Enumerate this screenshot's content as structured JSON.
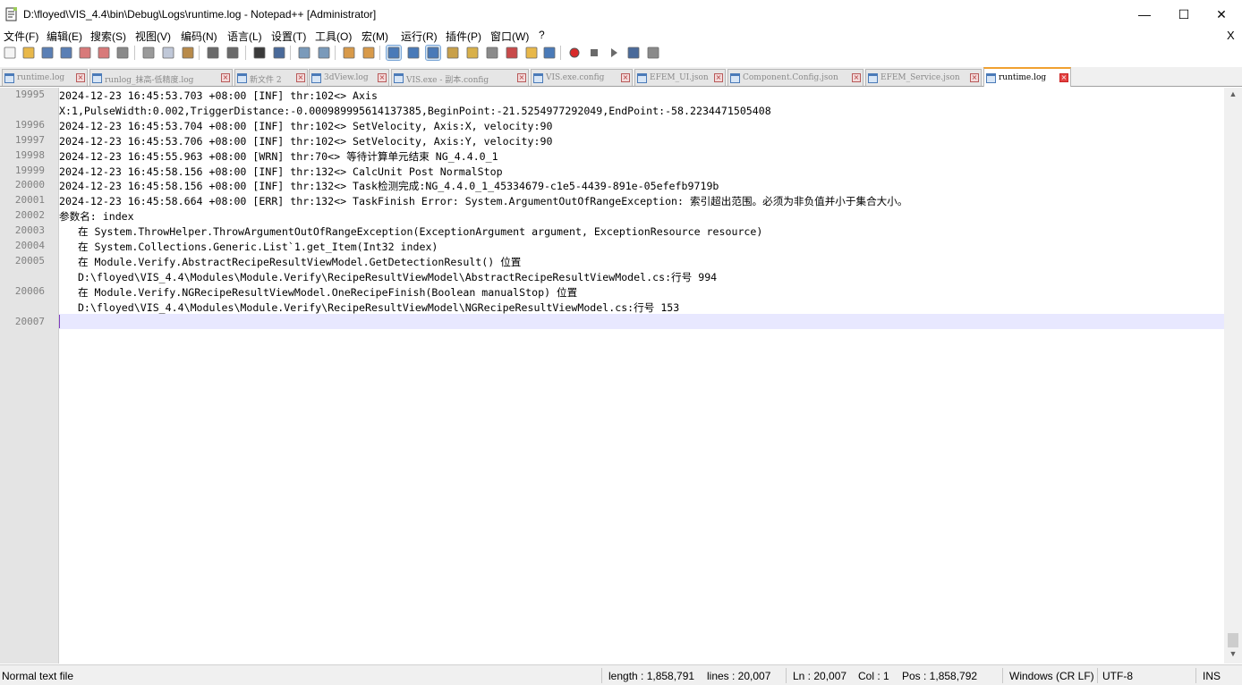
{
  "window": {
    "title": "D:\\floyed\\VIS_4.4\\bin\\Debug\\Logs\\runtime.log - Notepad++ [Administrator]",
    "minimize_glyph": "—",
    "maximize_glyph": "☐",
    "close_glyph": "✕"
  },
  "menu": {
    "items": [
      "文件(F)",
      "编辑(E)",
      "搜索(S)",
      "视图(V)",
      "编码(N)",
      "语言(L)",
      "设置(T)",
      "工具(O)",
      "宏(M)",
      "运行(R)",
      "插件(P)",
      "窗口(W)",
      "?"
    ],
    "close_glyph": "X"
  },
  "toolbar": {
    "buttons": [
      {
        "name": "new-file-icon",
        "color": "#f4f4f4"
      },
      {
        "name": "open-file-icon",
        "color": "#e8b84a"
      },
      {
        "name": "save-icon",
        "color": "#5a7fb5"
      },
      {
        "name": "save-all-icon",
        "color": "#5a7fb5"
      },
      {
        "name": "close-icon",
        "color": "#d87a7a"
      },
      {
        "name": "close-all-icon",
        "color": "#d87a7a"
      },
      {
        "name": "print-icon",
        "color": "#8a8a8a"
      },
      {
        "name": "cut-icon",
        "color": "#9a9a9a"
      },
      {
        "name": "copy-icon",
        "color": "#c0c8d8"
      },
      {
        "name": "paste-icon",
        "color": "#b88a4a"
      },
      {
        "name": "undo-icon",
        "color": "#6a6a6a"
      },
      {
        "name": "redo-icon",
        "color": "#6a6a6a"
      },
      {
        "name": "find-icon",
        "color": "#3a3a3a"
      },
      {
        "name": "replace-icon",
        "color": "#4a6a9a"
      },
      {
        "name": "zoom-in-icon",
        "color": "#7a9aba"
      },
      {
        "name": "zoom-out-icon",
        "color": "#7a9aba"
      },
      {
        "name": "sync-vertical-icon",
        "color": "#d89a4a"
      },
      {
        "name": "sync-horizontal-icon",
        "color": "#d89a4a"
      },
      {
        "name": "word-wrap-icon",
        "color": "#4a7ab8"
      },
      {
        "name": "show-all-chars-icon",
        "color": "#4a7ab8"
      },
      {
        "name": "indent-guide-icon",
        "color": "#4a7ab8"
      },
      {
        "name": "define-language-icon",
        "color": "#c8a04a"
      },
      {
        "name": "doc-map-icon",
        "color": "#d8b04a"
      },
      {
        "name": "doc-list-icon",
        "color": "#8a8a8a"
      },
      {
        "name": "function-list-icon",
        "color": "#c84a4a"
      },
      {
        "name": "folder-workspace-icon",
        "color": "#e8b84a"
      },
      {
        "name": "monitoring-icon",
        "color": "#4a7ab8"
      },
      {
        "name": "record-macro-icon",
        "color": "#d82a2a"
      },
      {
        "name": "stop-record-icon",
        "color": "#6a6a6a"
      },
      {
        "name": "play-macro-icon",
        "color": "#6a6a6a"
      },
      {
        "name": "run-macro-multiple-icon",
        "color": "#4a6a9a"
      },
      {
        "name": "save-macro-icon",
        "color": "#8a8a8a"
      }
    ]
  },
  "tabs": [
    {
      "label": "runtime.log",
      "active": false
    },
    {
      "label": "runlog_抹高-低精度.log",
      "active": false
    },
    {
      "label": "新文件 2",
      "active": false
    },
    {
      "label": "3dView.log",
      "active": false
    },
    {
      "label": "VIS.exe - 副本.config",
      "active": false
    },
    {
      "label": "VIS.exe.config",
      "active": false
    },
    {
      "label": "EFEM_UI.json",
      "active": false
    },
    {
      "label": "Component.Config.json",
      "active": false
    },
    {
      "label": "EFEM_Service.json",
      "active": false
    },
    {
      "label": "runtime.log",
      "active": true
    }
  ],
  "editor": {
    "line_numbers": [
      "19995",
      "",
      "19996",
      "19997",
      "19998",
      "19999",
      "20000",
      "20001",
      "20002",
      "20003",
      "20004",
      "20005",
      "",
      "20006",
      "",
      "20007"
    ],
    "lines": [
      "2024-12-23 16:45:53.703 +08:00 [INF] thr:102<> Axis",
      "X:1,PulseWidth:0.002,TriggerDistance:-0.000989995614137385,BeginPoint:-21.5254977292049,EndPoint:-58.2234471505408",
      "2024-12-23 16:45:53.704 +08:00 [INF] thr:102<> SetVelocity, Axis:X, velocity:90",
      "2024-12-23 16:45:53.706 +08:00 [INF] thr:102<> SetVelocity, Axis:Y, velocity:90",
      "2024-12-23 16:45:55.963 +08:00 [WRN] thr:70<> 等待计算单元结束 NG_4.4.0_1",
      "2024-12-23 16:45:58.156 +08:00 [INF] thr:132<> CalcUnit Post NormalStop",
      "2024-12-23 16:45:58.156 +08:00 [INF] thr:132<> Task检测完成:NG_4.4.0_1_45334679-c1e5-4439-891e-05efefb9719b",
      "2024-12-23 16:45:58.664 +08:00 [ERR] thr:132<> TaskFinish Error: System.ArgumentOutOfRangeException: 索引超出范围。必须为非负值并小于集合大小。",
      "参数名: index",
      "   在 System.ThrowHelper.ThrowArgumentOutOfRangeException(ExceptionArgument argument, ExceptionResource resource)",
      "   在 System.Collections.Generic.List`1.get_Item(Int32 index)",
      "   在 Module.Verify.AbstractRecipeResultViewModel.GetDetectionResult() 位置",
      "   D:\\floyed\\VIS_4.4\\Modules\\Module.Verify\\RecipeResultViewModel\\AbstractRecipeResultViewModel.cs:行号 994",
      "   在 Module.Verify.NGRecipeResultViewModel.OneRecipeFinish(Boolean manualStop) 位置",
      "   D:\\floyed\\VIS_4.4\\Modules\\Module.Verify\\RecipeResultViewModel\\NGRecipeResultViewModel.cs:行号 153",
      ""
    ],
    "caret_line_color": "#e8e8ff",
    "gutter_color": "#e4e4e4"
  },
  "scrollbar": {
    "up_glyph": "▲",
    "down_glyph": "▼"
  },
  "status": {
    "file_type": "Normal text file",
    "length": "length : 1,858,791",
    "lines": "lines : 20,007",
    "ln": "Ln : 20,007",
    "col": "Col : 1",
    "pos": "Pos : 1,858,792",
    "eol": "Windows (CR LF)",
    "encoding": "UTF-8",
    "mode": "INS"
  }
}
